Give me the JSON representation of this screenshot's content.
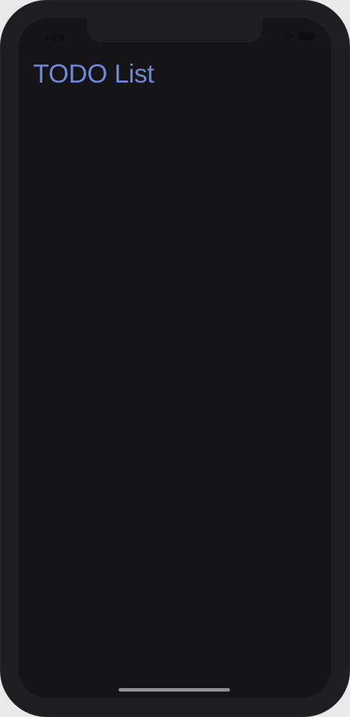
{
  "status_bar": {
    "time": "1:28",
    "wifi_icon": "wifi-icon",
    "battery_icon": "battery-icon"
  },
  "header": {
    "title": "TODO List"
  },
  "colors": {
    "title": "#6f87d8",
    "background": "#151517",
    "device_frame": "#1e1e20"
  }
}
